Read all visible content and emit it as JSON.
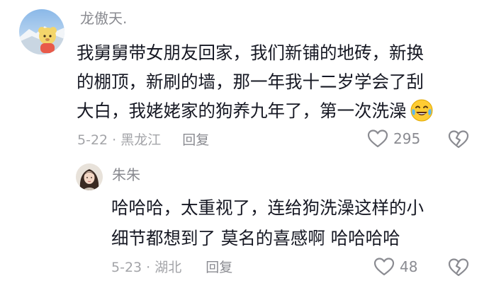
{
  "comments": [
    {
      "username": "龙傲天.",
      "lines": [
        "我舅舅带女朋友回家，我们新铺的地砖，新换",
        "的棚顶，新刷的墙，那一年我十二岁学会了刮",
        "大白，我姥姥家的狗养九年了，第一次洗澡"
      ],
      "emoji": "crying-laughing-emoji",
      "date_location": "5-22 · 黑龙江",
      "reply_label": "回复",
      "likes": "295"
    },
    {
      "username": "朱朱",
      "lines": [
        "哈哈哈，太重视了，连给狗洗澡这样的小",
        "细节都想到了 莫名的喜感啊 哈哈哈哈"
      ],
      "date_location": "5-23 · 湖北",
      "reply_label": "回复",
      "likes": "48"
    }
  ],
  "colors": {
    "username": "#8a8b91",
    "text": "#161823",
    "meta": "#a3a4a8"
  }
}
